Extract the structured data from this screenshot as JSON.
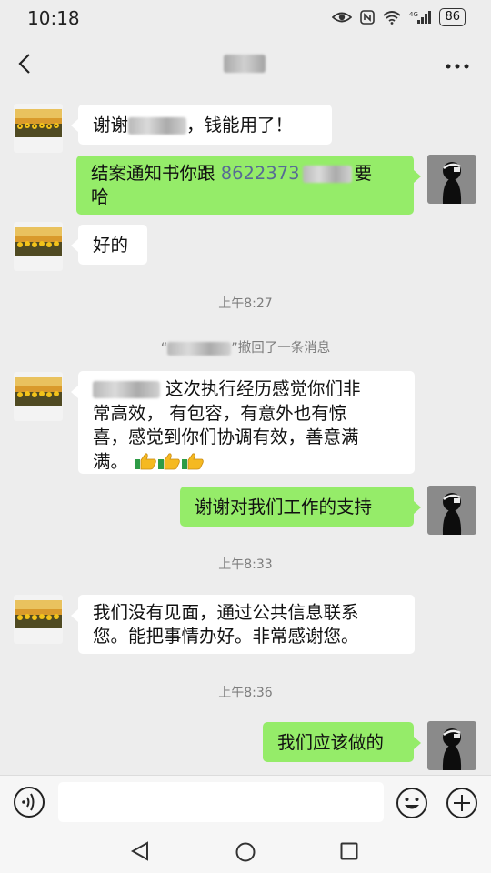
{
  "status_bar": {
    "time": "10:18",
    "battery": "86",
    "icons": [
      "eye-icon",
      "nfc-icon",
      "wifi-icon",
      "cellular-signal-icon",
      "battery-icon"
    ]
  },
  "title_bar": {
    "back_icon": "chevron-left-icon",
    "more_icon": "more-dots-icon"
  },
  "messages": [
    {
      "side": "left",
      "kind": "text",
      "before_blur": "谢谢",
      "after_blur": "，钱能用了！"
    },
    {
      "side": "right",
      "kind": "text",
      "line1_a": "结案通知书你跟 ",
      "line1_phone": "8622373",
      "line1_b": "要",
      "line2": "哈"
    },
    {
      "side": "left",
      "kind": "text",
      "text": "好的"
    },
    {
      "kind": "timestamp",
      "text": "上午8:27"
    },
    {
      "kind": "recall",
      "open_quote": "“",
      "close": "”撤回了一条消息"
    },
    {
      "side": "left",
      "kind": "text",
      "part1": "这次执行经历感觉你们非",
      "line2": "常高效，  有包容，有意外也有惊",
      "line3": "喜，感觉到你们协调有效，善意满",
      "line4": "满。",
      "emoji": [
        "thumbs-up-icon",
        "thumbs-up-icon",
        "thumbs-up-icon"
      ]
    },
    {
      "side": "right",
      "kind": "text",
      "text": "谢谢对我们工作的支持"
    },
    {
      "kind": "timestamp",
      "text": "上午8:33"
    },
    {
      "side": "left",
      "kind": "text",
      "line1": "我们没有见面，通过公共信息联系",
      "line2": "您。能把事情办好。非常感谢您。"
    },
    {
      "kind": "timestamp",
      "text": "上午8:36"
    },
    {
      "side": "right",
      "kind": "text",
      "text": "我们应该做的"
    }
  ],
  "input_bar": {
    "voice_icon": "voice-icon",
    "placeholder": "",
    "emoji_icon": "emoji-smile-icon",
    "plus_icon": "plus-circle-icon"
  },
  "nav_bar": {
    "icons": [
      "nav-back-icon",
      "nav-home-icon",
      "nav-recent-icon"
    ]
  },
  "colors": {
    "background": "#ededed",
    "bubble_self": "#95ec69",
    "bubble_other": "#ffffff",
    "link": "#576b95"
  }
}
